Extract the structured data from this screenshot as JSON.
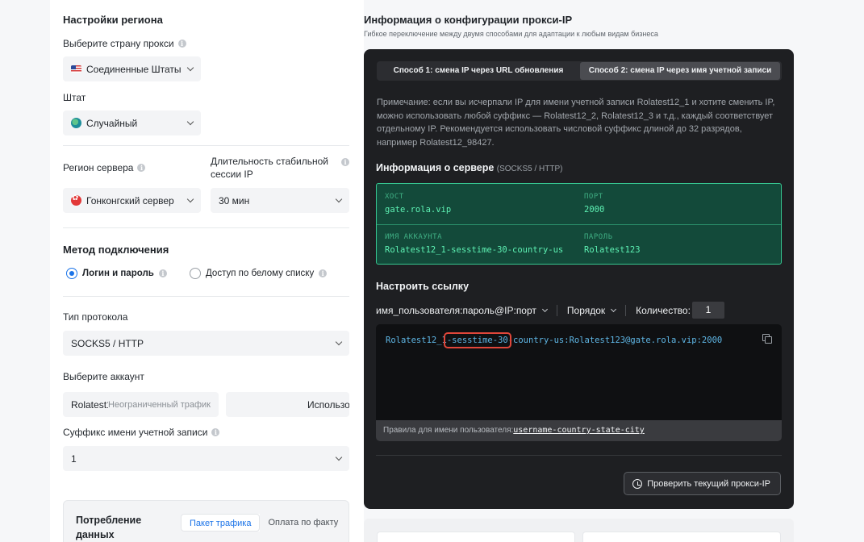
{
  "region": {
    "title": "Настройки региона",
    "country_label": "Выберите страну прокси",
    "country_value": "Соединенные Штаты /",
    "state_label": "Штат",
    "state_value": "Случайный",
    "server_region_label": "Регион сервера",
    "server_region_value": "Гонконгский сервер",
    "session_label": "Длительность стабильной сессии IP",
    "session_value": "30 мин"
  },
  "connection": {
    "title": "Метод подключения",
    "opt_login": "Логин и пароль",
    "opt_whitelist": "Доступ по белому списку",
    "protocol_label": "Тип протокола",
    "protocol_value": "SOCKS5 / HTTP",
    "account_label": "Выберите аккаунт",
    "account_value": "Rolatest12",
    "account_traffic": "Неограниченный трафик",
    "account_used": "Использовано",
    "suffix_label": "Суффикс имени учетной записи",
    "suffix_value": "1"
  },
  "consumption": {
    "title": "Потребление данных",
    "seg_package": "Пакет трафика",
    "seg_payg": "Оплата по факту"
  },
  "info": {
    "title": "Информация о конфигурации прокси-IP",
    "subtitle": "Гибкое переключение между двумя способами для адаптации к любым видам бизнеса",
    "tab1": "Способ 1: смена IP через URL обновления",
    "tab2": "Способ 2: смена IP через имя учетной записи",
    "note": "Примечание: если вы исчерпали IP для имени учетной записи Rolatest12_1 и хотите сменить IP, можно использовать любой суффикс — Rolatest12_2, Rolatest12_3 и т.д., каждый соответствует отдельному IP. Рекомендуется использовать числовой суффикс длиной до 32 разрядов, например Rolatest12_98427."
  },
  "server": {
    "title": "Информация о сервере",
    "proto": "(SOCKS5 / HTTP)",
    "host_key": "ХОСТ",
    "host_val": "gate.rola.vip",
    "port_key": "ПОРТ",
    "port_val": "2000",
    "acc_key": "ИМЯ АККАУНТА",
    "acc_val": "Rolatest12_1-sesstime-30-country-us",
    "pass_key": "ПАРОЛЬ",
    "pass_val": "Rolatest123"
  },
  "link": {
    "title": "Настроить ссылку",
    "format": "имя_пользователя:пароль@IP:порт",
    "order": "Порядок",
    "qty_label": "Количество:",
    "qty_val": "1",
    "code_pre": "Rolatest12_1",
    "code_hl": "-sesstime-30",
    "code_post": "-country-us:Rolatest123@gate.rola.vip:2000",
    "rules_label": "Правила для имени пользователя:",
    "rules_value": "username-country-state-city",
    "check_btn": "Проверить текущий прокси-IP"
  }
}
